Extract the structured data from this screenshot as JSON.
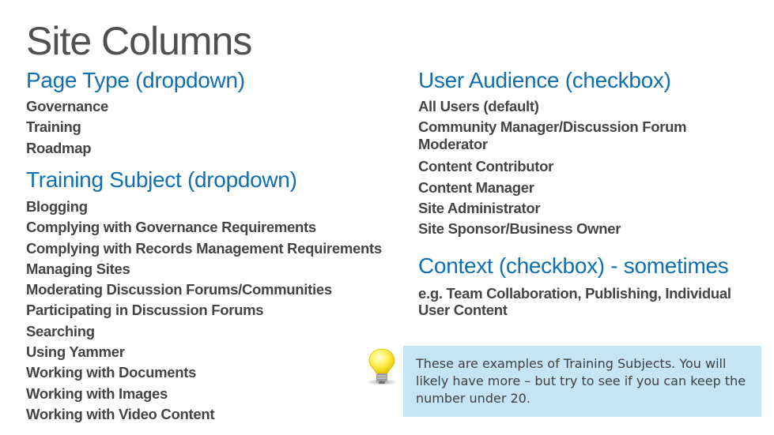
{
  "colors": {
    "heading": "#0F6FB0",
    "body_text": "#444444",
    "title": "#505050",
    "callout_bg": "#C5E5F5"
  },
  "page": {
    "title": "Site Columns"
  },
  "left": {
    "page_type": {
      "heading": "Page Type (dropdown)",
      "items": [
        "Governance",
        "Training",
        "Roadmap"
      ]
    },
    "training_subject": {
      "heading": "Training Subject (dropdown)",
      "items": [
        "Blogging",
        "Complying with Governance Requirements",
        "Complying with Records Management Requirements",
        "Managing Sites",
        "Moderating Discussion Forums/Communities",
        "Participating in Discussion Forums",
        "Searching",
        "Using Yammer",
        "Working with Documents",
        "Working with Images",
        "Working with Video Content"
      ]
    }
  },
  "right": {
    "user_audience": {
      "heading": "User Audience (checkbox)",
      "items": [
        "All Users (default)",
        "Community Manager/Discussion Forum Moderator",
        "Content Contributor",
        "Content Manager",
        "Site Administrator",
        "Site Sponsor/Business Owner"
      ]
    },
    "context": {
      "heading": "Context (checkbox) - sometimes",
      "text": "e.g. Team Collaboration, Publishing, Individual User Content"
    }
  },
  "callout": {
    "icon": "lightbulb-icon",
    "text": "These are examples of Training Subjects. You will likely have more – but try to see if you can keep the number under 20."
  }
}
